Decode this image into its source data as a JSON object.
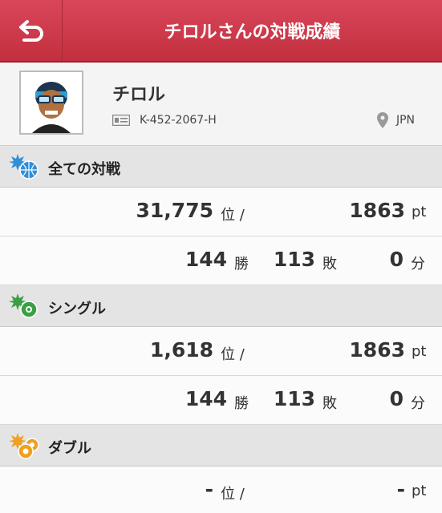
{
  "header": {
    "title": "チロルさんの対戦成績",
    "back_icon": "back-arrow-icon"
  },
  "profile": {
    "name": "チロル",
    "trainer_id": "K-452-2067-H",
    "location": "JPN",
    "avatar_icon": "trainer-avatar"
  },
  "sections": [
    {
      "label": "全ての対戦",
      "icon": "globe-burst-icon",
      "rank": "31,775",
      "rank_unit": "位 /",
      "points": "1863",
      "points_unit": "pt",
      "wins": "144",
      "wins_unit": "勝",
      "losses": "113",
      "losses_unit": "敗",
      "draws": "0",
      "draws_unit": "分"
    },
    {
      "label": "シングル",
      "icon": "single-ball-icon",
      "rank": "1,618",
      "rank_unit": "位 /",
      "points": "1863",
      "points_unit": "pt",
      "wins": "144",
      "wins_unit": "勝",
      "losses": "113",
      "losses_unit": "敗",
      "draws": "0",
      "draws_unit": "分"
    },
    {
      "label": "ダブル",
      "icon": "double-ball-icon",
      "rank": "-",
      "rank_unit": "位 /",
      "points": "-",
      "points_unit": "pt"
    }
  ],
  "colors": {
    "header": "#c8374a",
    "accent_blue": "#2f8fd8",
    "accent_green": "#3aa043",
    "accent_orange": "#f0a020"
  }
}
